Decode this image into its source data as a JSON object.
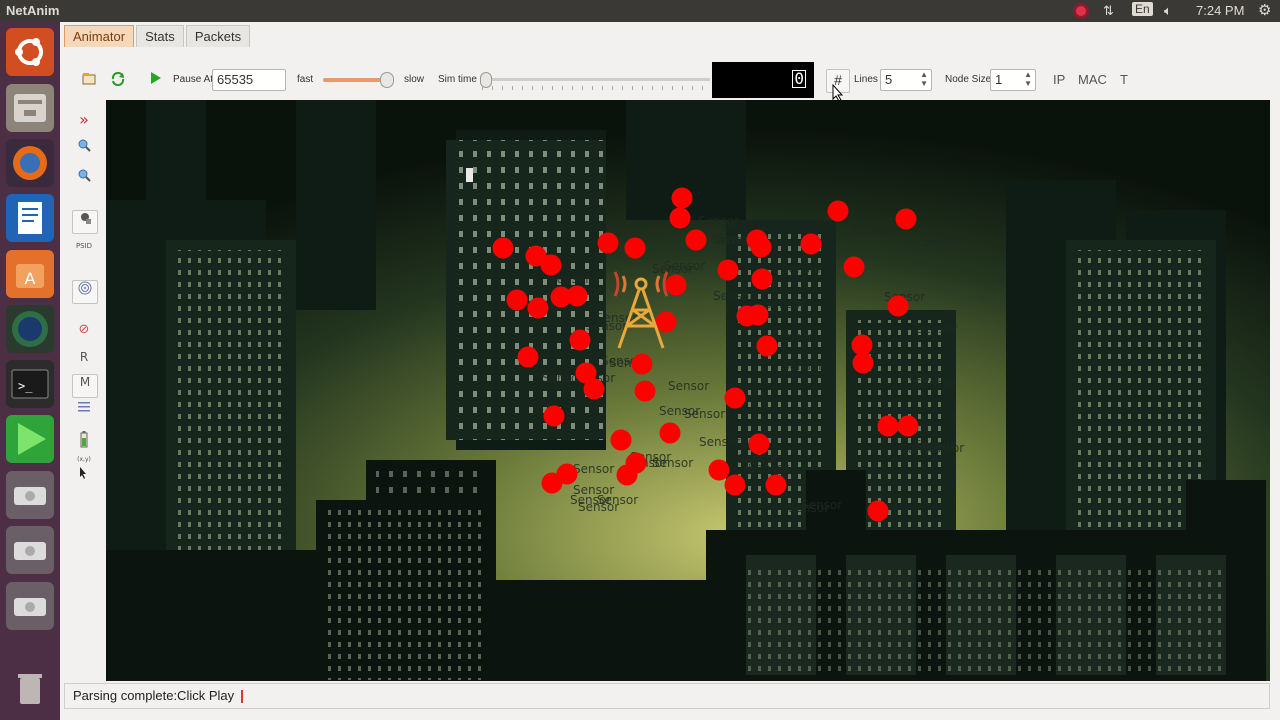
{
  "system": {
    "app_title": "NetAnim",
    "lang": "En",
    "clock": "7:24 PM"
  },
  "tabs": [
    {
      "label": "Animator",
      "active": true
    },
    {
      "label": "Stats"
    },
    {
      "label": "Packets"
    }
  ],
  "toolbar": {
    "pause_at_label": "Pause At",
    "pause_at_value": "65535",
    "fast_label": "fast",
    "slow_label": "slow",
    "sim_time_label": "Sim time",
    "sim_time_display": "0",
    "lines_label": "Lines",
    "lines_value": "5",
    "node_size_label": "Node Size",
    "node_size_value": "1",
    "ip_label": "IP",
    "mac_label": "MAC",
    "t_label": "T"
  },
  "sidebar": {
    "r_label": "R",
    "m_label": "M",
    "psid_label": "PSID",
    "xy_label": "(x,y)"
  },
  "status": {
    "text": "Parsing complete:Click Play"
  },
  "scene": {
    "node_label": "Sensor",
    "node_color": "#ff0000",
    "tower_color": "#e8a83a"
  }
}
